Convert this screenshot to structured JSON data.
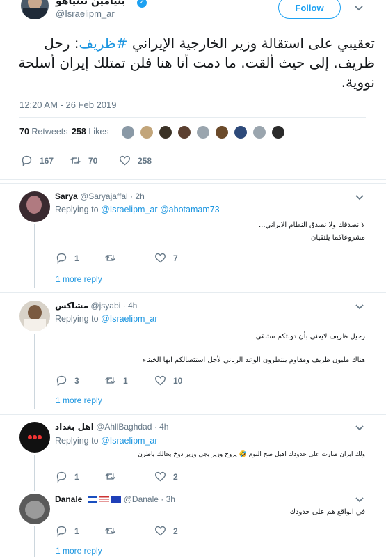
{
  "header": {
    "display_name": "بنيامين نتنياهو",
    "handle": "@Israelipm_ar",
    "follow_label": "Follow"
  },
  "tweet": {
    "text_line1_pre": "تعقيبي على استقالة وزير الخارجية الإيراني ",
    "text_hashtag": "#ظريف",
    "text_line1_post": ": رحل",
    "text_line2": "ظريف. إلى حيث ألقت. ما دمت أنا هنا فلن تمتلك إيران أسلحة",
    "text_line3": "نووية.",
    "timestamp": "12:20 AM - 26 Feb 2019",
    "retweets_count": "70",
    "retweets_label": "Retweets",
    "likes_count": "258",
    "likes_label": "Likes",
    "replies": "167",
    "retweets": "70",
    "likes": "258"
  },
  "replies": [
    {
      "name": "Sarya",
      "handle": "@Saryajaffal",
      "time": "· 2h",
      "replying_label": "Replying to",
      "replying_to_1": "@Israelipm_ar",
      "replying_to_2": "@abotamam73",
      "line1": "لا نصدقك ولا نصدق النظام الايراني...",
      "line2": "مشروعاكما يلتقيان",
      "replies": "1",
      "retweets": "",
      "likes": "7",
      "more": "1 more reply"
    },
    {
      "name": "مشاكس",
      "handle": "@jsyabi",
      "time": "· 4h",
      "replying_label": "Replying to",
      "replying_to_1": "@Israelipm_ar",
      "line1": "رحيل ظريف لايعني بأن دولتكم ستبقى",
      "line2": "هناك مليون ظريف ومقاوم ينتظرون الوعد الرباني لأجل استئصالكم ايها الخبثاء",
      "replies": "3",
      "retweets": "1",
      "likes": "10",
      "more": "1 more reply"
    },
    {
      "name": "اهل بغداد",
      "handle": "@AhllBaghdad",
      "time": "· 4h",
      "replying_label": "Replying to",
      "replying_to_1": "@Israelipm_ar",
      "line1": "ولك ايران صارت على حدودك اهبل صح النوم 🤣 يروح وزير يجي وزير دوخ بحالك ياطرن",
      "replies": "1",
      "retweets": "",
      "likes": "2"
    },
    {
      "name": "Danale",
      "handle": "@Danale",
      "time": "· 3h",
      "line1": "في الواقع هم على حدودك",
      "replies": "1",
      "retweets": "",
      "likes": "2",
      "more": "1 more reply"
    }
  ],
  "colors": {
    "accent": "#1b95e0",
    "muted": "#657786",
    "divider": "#e6ecf0"
  }
}
